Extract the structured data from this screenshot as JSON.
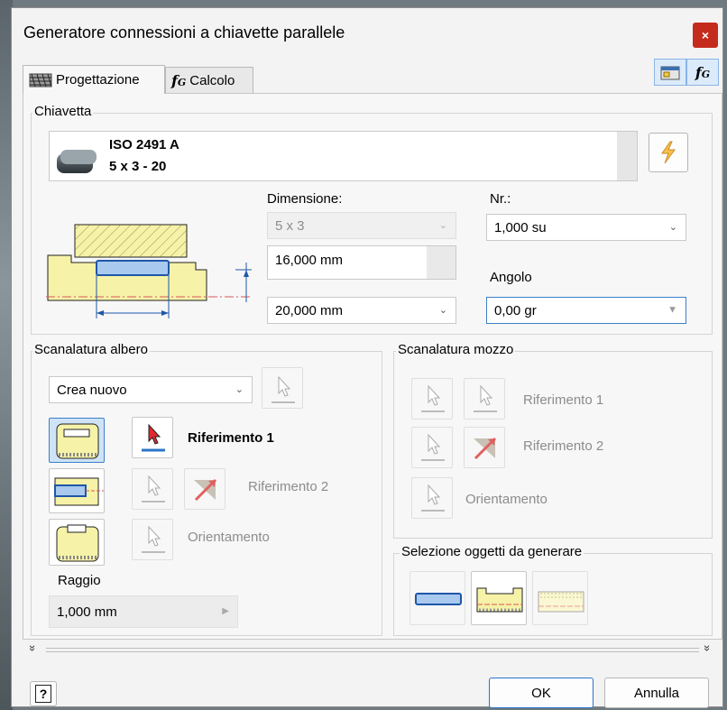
{
  "window": {
    "title": "Generatore connessioni a chiavette parallele",
    "close_glyph": "×"
  },
  "tabs": [
    {
      "label": "Progettazione",
      "icon": "design-icon"
    },
    {
      "label": "Calcolo",
      "icon": "calculation-fx-icon"
    }
  ],
  "key": {
    "group_label": "Chiavetta",
    "standard": "ISO 2491 A",
    "size_designation": "5 x 3 - 20",
    "dimension_label": "Dimensione:",
    "dimension_value": "5 x 3",
    "count_label": "Nr.:",
    "count_value": "1,000 su",
    "width_value": "16,000 mm",
    "length_value": "20,000 mm",
    "angle_label": "Angolo",
    "angle_value": "0,00 gr"
  },
  "shaft_groove": {
    "group_label": "Scanalatura albero",
    "mode_value": "Crea nuovo",
    "ref1_label": "Riferimento 1",
    "ref2_label": "Riferimento 2",
    "orient_label": "Orientamento",
    "radius_label": "Raggio",
    "radius_value": "1,000 mm"
  },
  "hub_groove": {
    "group_label": "Scanalatura mozzo",
    "ref1_label": "Riferimento 1",
    "ref2_label": "Riferimento 2",
    "orient_label": "Orientamento"
  },
  "generate": {
    "group_label": "Selezione oggetti da generare"
  },
  "footer": {
    "help_glyph": "?",
    "ok_label": "OK",
    "cancel_label": "Annulla",
    "expand_glyph": "»"
  },
  "colors": {
    "accent": "#3c80c8",
    "close": "#c42b1c",
    "yellow": "#f6f2a8",
    "key_blue": "#a9c9ef"
  }
}
